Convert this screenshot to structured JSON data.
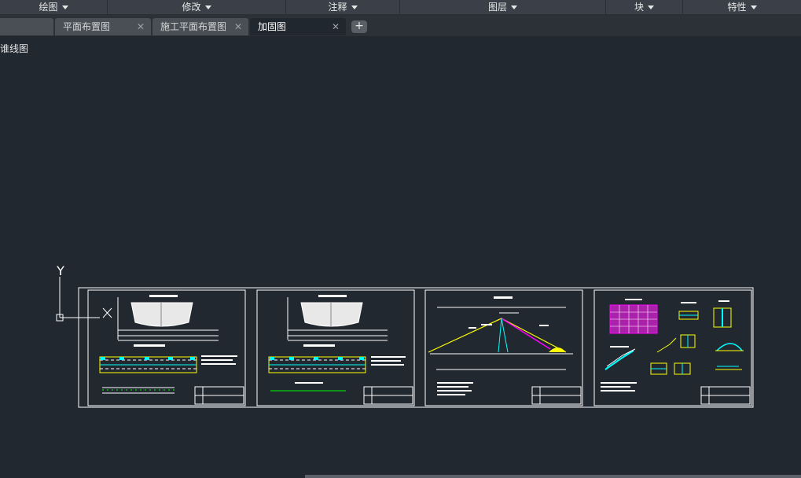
{
  "ribbon": {
    "panels": [
      {
        "label": "绘图"
      },
      {
        "label": "修改"
      },
      {
        "label": "注释"
      },
      {
        "label": "图层"
      },
      {
        "label": "块"
      },
      {
        "label": "特性"
      }
    ]
  },
  "tabs": [
    {
      "label": ""
    },
    {
      "label": "平面布置图"
    },
    {
      "label": "施工平面布置图"
    },
    {
      "label": "加固图"
    }
  ],
  "active_tab": "加固图",
  "viewport": {
    "label": "谁线图"
  },
  "ucs": {
    "y_label": "Y",
    "x_label": "X"
  },
  "colors": {
    "canvas_bg": "#212830",
    "sheet_border": "#ffffff",
    "accent_yellow": "#ffff00",
    "accent_cyan": "#00ffff",
    "accent_magenta": "#ff00ff",
    "accent_green": "#00ff00"
  }
}
